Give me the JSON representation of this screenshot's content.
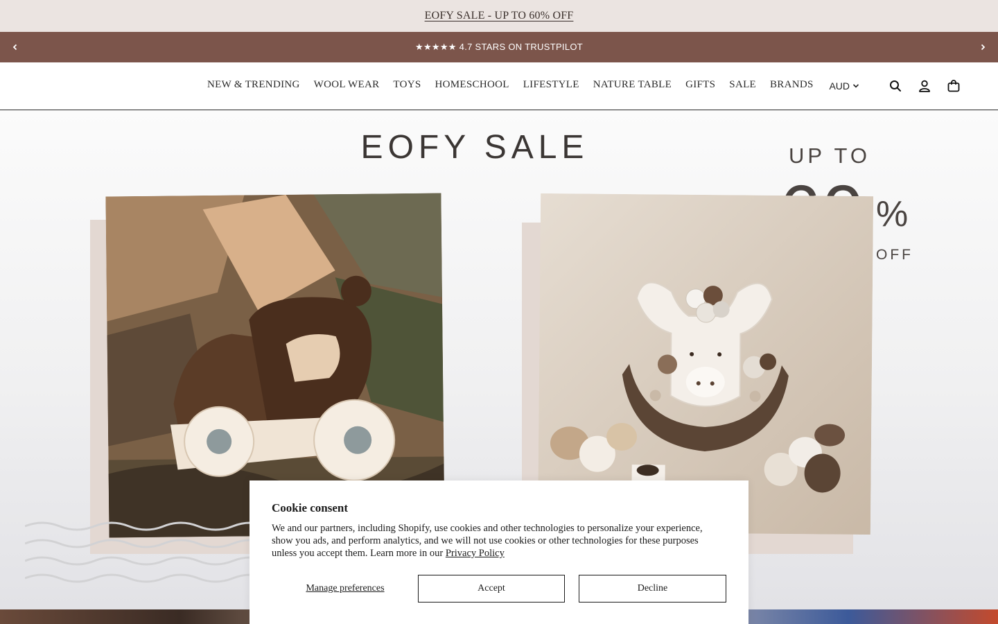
{
  "announcement": {
    "text": "EOFY SALE - UP TO 60% OFF"
  },
  "trust_bar": {
    "text": "★★★★★ 4.7 STARS ON TRUSTPILOT",
    "prev_icon": "chevron-left-icon",
    "next_icon": "chevron-right-icon"
  },
  "nav": {
    "items": [
      "NEW & TRENDING",
      "WOOL WEAR",
      "TOYS",
      "HOMESCHOOL",
      "LIFESTYLE",
      "NATURE TABLE",
      "GIFTS",
      "SALE",
      "BRANDS"
    ]
  },
  "header": {
    "currency": "AUD",
    "icons": [
      "search-icon",
      "account-icon",
      "cart-icon"
    ]
  },
  "hero": {
    "title": "EOFY SALE",
    "up_to": "UP TO",
    "discount": "60",
    "percent": "%",
    "off": "OFF",
    "images": [
      "wooden-toy-car-photo",
      "wooden-moose-balance-toy-photo"
    ]
  },
  "cookie": {
    "title": "Cookie consent",
    "body": "We and our partners, including Shopify, use cookies and other technologies to personalize your experience, show you ads, and perform analytics, and we will not use cookies or other technologies for these purposes unless you accept them. Learn more in our ",
    "link": "Privacy Policy",
    "manage": "Manage preferences",
    "accept": "Accept",
    "decline": "Decline"
  },
  "colors": {
    "announce_bg": "#ebe4e1",
    "trust_bg": "#7c554b",
    "text": "#2a2a2a"
  }
}
